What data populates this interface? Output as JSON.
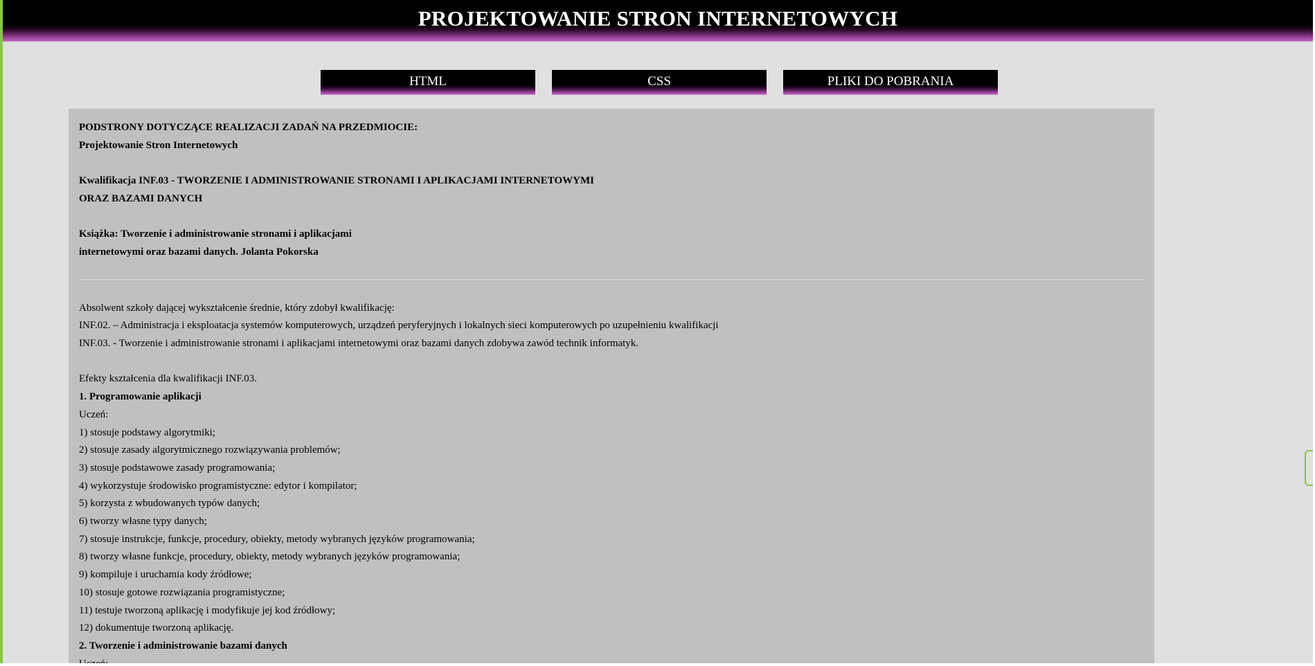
{
  "header": {
    "title": "PROJEKTOWANIE STRON INTERNETOWYCH"
  },
  "nav": {
    "items": [
      {
        "label": "HTML"
      },
      {
        "label": "CSS"
      },
      {
        "label": "PLIKI DO POBRANIA"
      }
    ]
  },
  "content": {
    "intro_line1": "PODSTRONY DOTYCZĄCE REALIZACJI ZADAŃ NA PRZEDMIOCIE:",
    "intro_line2": "Projektowanie Stron Internetowych",
    "qualification_line1": "Kwalifikacja INF.03 - TWORZENIE I ADMINISTROWANIE STRONAMI I APLIKACJAMI INTERNETOWYMI",
    "qualification_line2": "ORAZ BAZAMI DANYCH",
    "book_line1": "Książka: Tworzenie i administrowanie stronami i aplikacjami",
    "book_line2": "internetowymi oraz bazami danych. Jolanta Pokorska",
    "graduate_line1": "Absolwent szkoły dającej wykształcenie średnie, który zdobył kwalifikację:",
    "graduate_line2": "INF.02. – Administracja i eksploatacja systemów komputerowych, urządzeń peryferyjnych i lokalnych sieci komputerowych po uzupełnieniu kwalifikacji",
    "graduate_line3": "INF.03. - Tworzenie i administrowanie stronami i aplikacjami internetowymi oraz bazami danych zdobywa zawód technik informatyk.",
    "effects_title": "Efekty kształcenia dla kwalifikacji INF.03.",
    "section1_title": "1. Programowanie aplikacji",
    "section1_student": "Uczeń:",
    "section1_items": [
      "1) stosuje podstawy algorytmiki;",
      "2) stosuje zasady algorytmicznego rozwiązywania problemów;",
      "3) stosuje podstawowe zasady programowania;",
      "4) wykorzystuje środowisko programistyczne: edytor i kompilator;",
      "5) korzysta z wbudowanych typów danych;",
      "6) tworzy własne typy danych;",
      "7) stosuje instrukcje, funkcje, procedury, obiekty, metody wybranych języków programowania;",
      "8) tworzy własne funkcje, procedury, obiekty, metody wybranych języków programowania;",
      "9) kompiluje i uruchamia kody źródłowe;",
      "10) stosuje gotowe rozwiązania programistyczne;",
      "11) testuje tworzoną aplikację i modyfikuje jej kod źródłowy;",
      "12) dokumentuje tworzoną aplikację."
    ],
    "section2_title": "2. Tworzenie i administrowanie bazami danych",
    "section2_student": "Uczeń:"
  }
}
